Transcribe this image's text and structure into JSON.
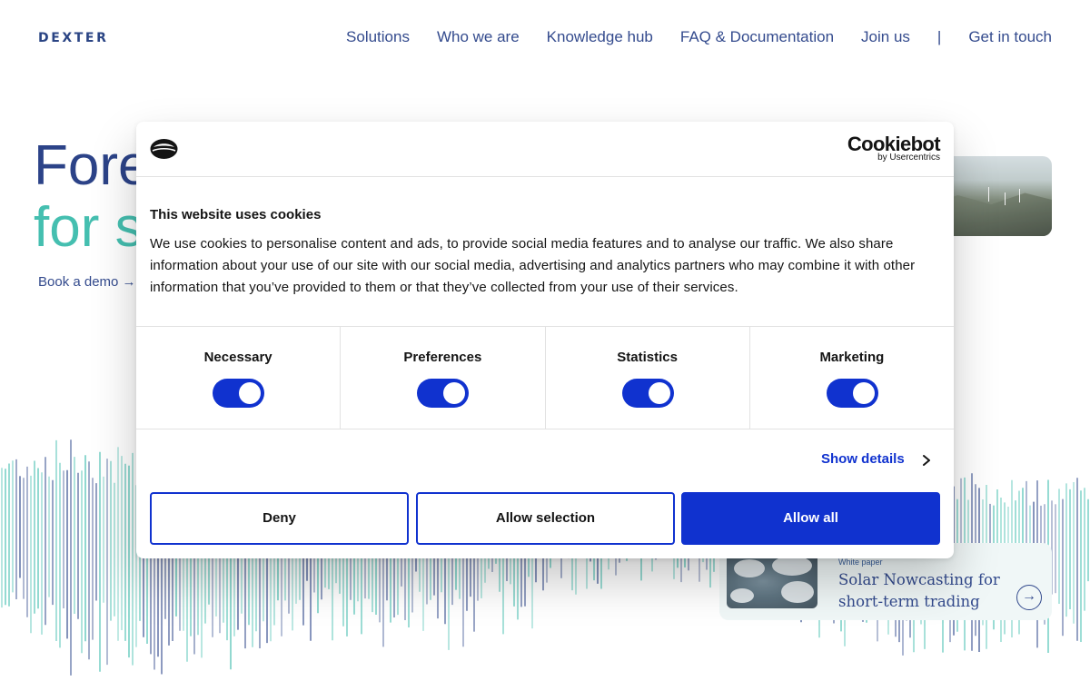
{
  "header": {
    "logo": "DEXTER",
    "nav": [
      "Solutions",
      "Who we are",
      "Knowledge hub",
      "FAQ & Documentation",
      "Join us",
      "|",
      "Get in touch"
    ]
  },
  "hero": {
    "line1": "Fore",
    "line2": "for s",
    "cta": "Book a demo →"
  },
  "card": {
    "kicker": "White paper",
    "title": "Solar Nowcasting for short-term trading",
    "arrow_icon": "arrow-right-circle-icon"
  },
  "cookie_dialog": {
    "brand": "Cookiebot",
    "brand_sub": "by Usercentrics",
    "title": "This website uses cookies",
    "text": "We use cookies to personalise content and ads, to provide social media features and to analyse our traffic. We also share information about your use of our site with our social media, advertising and analytics partners who may combine it with other information that you’ve provided to them or that they’ve collected from your use of their services.",
    "categories": [
      {
        "label": "Necessary",
        "checked": true
      },
      {
        "label": "Preferences",
        "checked": true
      },
      {
        "label": "Statistics",
        "checked": true
      },
      {
        "label": "Marketing",
        "checked": true
      }
    ],
    "show_details": "Show details",
    "buttons": {
      "deny": "Deny",
      "allow_selection": "Allow selection",
      "allow_all": "Allow all"
    }
  },
  "colors": {
    "navy": "#17327e",
    "teal": "#2cb7a6",
    "accent_blue": "#1032cf"
  }
}
